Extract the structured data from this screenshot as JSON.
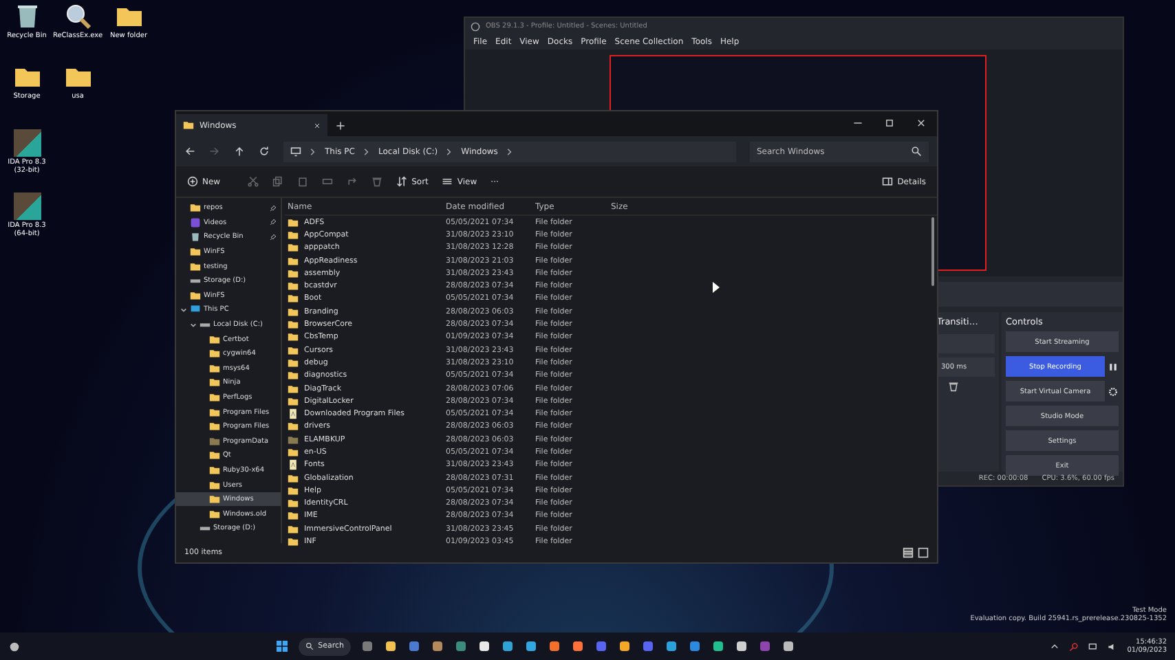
{
  "desktop": {
    "icons": [
      {
        "label": "Recycle Bin",
        "kind": "recycle"
      },
      {
        "label": "ReClassEx.exe",
        "kind": "app"
      },
      {
        "label": "New folder",
        "kind": "folder"
      },
      {
        "label": "Storage",
        "kind": "folder"
      },
      {
        "label": "usa",
        "kind": "folder"
      },
      {
        "label": "IDA Pro 8.3 (32-bit)",
        "kind": "ida"
      },
      {
        "label": "IDA Pro 8.3 (64-bit)",
        "kind": "ida"
      }
    ],
    "watermark": [
      "Test Mode",
      "Evaluation copy. Build 25941.rs_prerelease.230825-1352"
    ]
  },
  "obs": {
    "title": "OBS 29.1.3 - Profile: Untitled - Scenes: Untitled",
    "menu": [
      "File",
      "Edit",
      "View",
      "Docks",
      "Profile",
      "Scene Collection",
      "Tools",
      "Help"
    ],
    "transitions": {
      "title": "Transiti…",
      "duration": "300 ms"
    },
    "controls": {
      "title": "Controls",
      "buttons": [
        {
          "label": "Start Streaming",
          "selected": false,
          "kind": "plain"
        },
        {
          "label": "Stop Recording",
          "selected": true,
          "kind": "pause"
        },
        {
          "label": "Start Virtual Camera",
          "selected": false,
          "kind": "gear"
        },
        {
          "label": "Studio Mode",
          "selected": false,
          "kind": "plain"
        },
        {
          "label": "Settings",
          "selected": false,
          "kind": "plain"
        },
        {
          "label": "Exit",
          "selected": false,
          "kind": "plain"
        }
      ]
    },
    "status": [
      "REC: 00:00:08",
      "CPU: 3.6%, 60.00 fps"
    ]
  },
  "explorer": {
    "tab": "Windows",
    "address": [
      "This PC",
      "Local Disk (C:)",
      "Windows"
    ],
    "search": {
      "placeholder": "Search Windows"
    },
    "toolbar": {
      "new": "New",
      "sort": "Sort",
      "view": "View",
      "more": "···",
      "details": "Details"
    },
    "sidebar": [
      {
        "label": "repos",
        "kind": "folder",
        "pinned": true,
        "selected": false
      },
      {
        "label": "Videos",
        "kind": "videos",
        "pinned": true,
        "selected": false
      },
      {
        "label": "Recycle Bin",
        "kind": "recycle",
        "pinned": true,
        "selected": false
      },
      {
        "label": "WinFS",
        "kind": "folder",
        "pinned": false,
        "selected": false
      },
      {
        "label": "testing",
        "kind": "folder",
        "pinned": false,
        "selected": false
      },
      {
        "label": "Storage (D:)",
        "kind": "drive",
        "pinned": false,
        "selected": false
      },
      {
        "label": "WinFS",
        "kind": "folder",
        "pinned": false,
        "selected": false
      },
      {
        "label": "This PC",
        "kind": "pc",
        "pinned": false,
        "selected": false,
        "children": [
          {
            "label": "Local Disk (C:)",
            "kind": "drive",
            "pinned": false,
            "selected": false,
            "children": [
              {
                "label": "Certbot",
                "kind": "folder",
                "pinned": false,
                "selected": false
              },
              {
                "label": "cygwin64",
                "kind": "folder",
                "pinned": false,
                "selected": false
              },
              {
                "label": "msys64",
                "kind": "folder",
                "pinned": false,
                "selected": false
              },
              {
                "label": "Ninja",
                "kind": "folder",
                "pinned": false,
                "selected": false
              },
              {
                "label": "PerfLogs",
                "kind": "folder",
                "pinned": false,
                "selected": false
              },
              {
                "label": "Program Files",
                "kind": "folder",
                "pinned": false,
                "selected": false
              },
              {
                "label": "Program Files",
                "kind": "folder",
                "pinned": false,
                "selected": false
              },
              {
                "label": "ProgramData",
                "kind": "hidden",
                "pinned": false,
                "selected": false
              },
              {
                "label": "Qt",
                "kind": "folder",
                "pinned": false,
                "selected": false
              },
              {
                "label": "Ruby30-x64",
                "kind": "folder",
                "pinned": false,
                "selected": false
              },
              {
                "label": "Users",
                "kind": "folder",
                "pinned": false,
                "selected": false
              },
              {
                "label": "Windows",
                "kind": "folder",
                "pinned": false,
                "selected": true
              },
              {
                "label": "Windows.old",
                "kind": "folder",
                "pinned": false,
                "selected": false
              }
            ]
          },
          {
            "label": "Storage (D:)",
            "kind": "drive",
            "pinned": false,
            "selected": false
          }
        ]
      }
    ],
    "columns": [
      "Name",
      "Date modified",
      "Type",
      "Size"
    ],
    "rows": [
      {
        "name": "ADFS",
        "date": "05/05/2021 07:34",
        "type": "File folder",
        "kind": "folder"
      },
      {
        "name": "AppCompat",
        "date": "31/08/2023 23:10",
        "type": "File folder",
        "kind": "folder"
      },
      {
        "name": "apppatch",
        "date": "31/08/2023 12:28",
        "type": "File folder",
        "kind": "folder"
      },
      {
        "name": "AppReadiness",
        "date": "31/08/2023 21:03",
        "type": "File folder",
        "kind": "folder"
      },
      {
        "name": "assembly",
        "date": "31/08/2023 23:43",
        "type": "File folder",
        "kind": "folder"
      },
      {
        "name": "bcastdvr",
        "date": "28/08/2023 07:34",
        "type": "File folder",
        "kind": "folder"
      },
      {
        "name": "Boot",
        "date": "05/05/2021 07:34",
        "type": "File folder",
        "kind": "folder"
      },
      {
        "name": "Branding",
        "date": "28/08/2023 06:03",
        "type": "File folder",
        "kind": "folder"
      },
      {
        "name": "BrowserCore",
        "date": "28/08/2023 07:34",
        "type": "File folder",
        "kind": "folder"
      },
      {
        "name": "CbsTemp",
        "date": "01/09/2023 07:34",
        "type": "File folder",
        "kind": "folder"
      },
      {
        "name": "Cursors",
        "date": "31/08/2023 23:43",
        "type": "File folder",
        "kind": "folder"
      },
      {
        "name": "debug",
        "date": "31/08/2023 23:10",
        "type": "File folder",
        "kind": "folder"
      },
      {
        "name": "diagnostics",
        "date": "05/05/2021 07:34",
        "type": "File folder",
        "kind": "folder"
      },
      {
        "name": "DiagTrack",
        "date": "28/08/2023 07:06",
        "type": "File folder",
        "kind": "folder"
      },
      {
        "name": "DigitalLocker",
        "date": "28/08/2023 07:34",
        "type": "File folder",
        "kind": "folder"
      },
      {
        "name": "Downloaded Program Files",
        "date": "05/05/2021 07:34",
        "type": "File folder",
        "kind": "special"
      },
      {
        "name": "drivers",
        "date": "28/08/2023 06:03",
        "type": "File folder",
        "kind": "folder"
      },
      {
        "name": "ELAMBKUP",
        "date": "28/08/2023 06:03",
        "type": "File folder",
        "kind": "hidden"
      },
      {
        "name": "en-US",
        "date": "05/05/2021 07:34",
        "type": "File folder",
        "kind": "folder"
      },
      {
        "name": "Fonts",
        "date": "31/08/2023 23:43",
        "type": "File folder",
        "kind": "special"
      },
      {
        "name": "Globalization",
        "date": "28/08/2023 07:31",
        "type": "File folder",
        "kind": "folder"
      },
      {
        "name": "Help",
        "date": "05/05/2021 07:34",
        "type": "File folder",
        "kind": "folder"
      },
      {
        "name": "IdentityCRL",
        "date": "28/08/2023 07:34",
        "type": "File folder",
        "kind": "folder"
      },
      {
        "name": "IME",
        "date": "28/08/2023 07:34",
        "type": "File folder",
        "kind": "folder"
      },
      {
        "name": "ImmersiveControlPanel",
        "date": "31/08/2023 23:45",
        "type": "File folder",
        "kind": "folder"
      },
      {
        "name": "INF",
        "date": "01/09/2023 03:45",
        "type": "File folder",
        "kind": "folder"
      }
    ],
    "status": "100 items"
  },
  "taskbar": {
    "search": "Search",
    "time": "15:46:32",
    "date": "01/09/2023"
  }
}
